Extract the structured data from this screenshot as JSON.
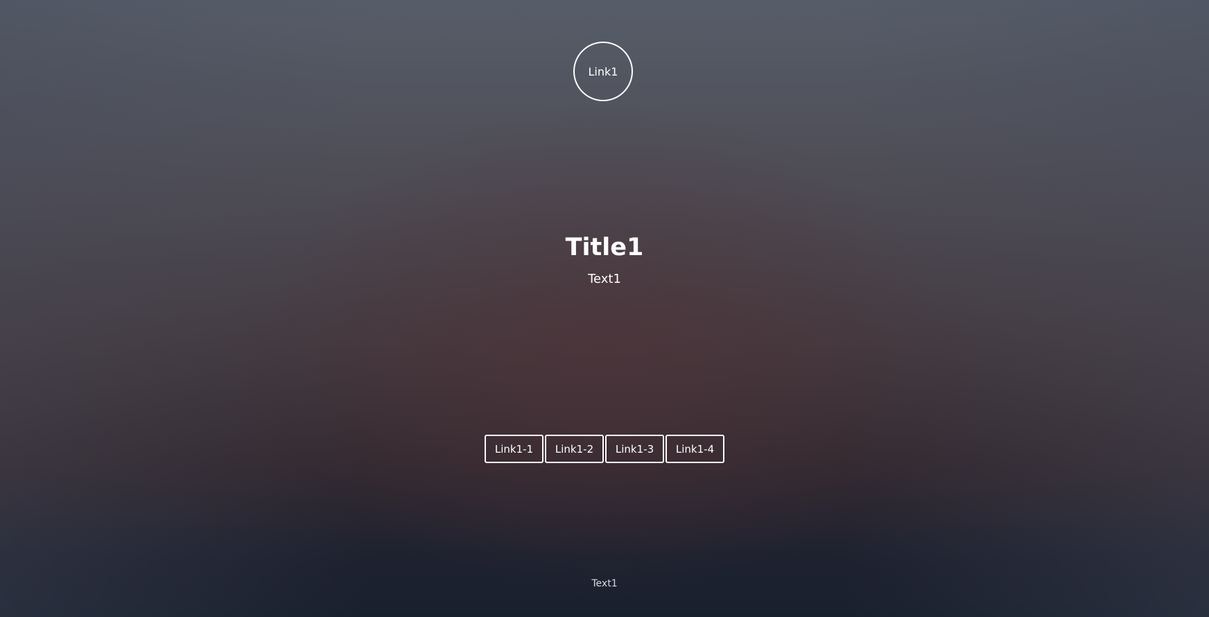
{
  "header": {
    "logo_link_label": "Link1"
  },
  "main": {
    "title": "Title1",
    "subtitle": "Text1",
    "nav_links": [
      "Link1-1",
      "Link1-2",
      "Link1-3",
      "Link1-4"
    ]
  },
  "footer": {
    "text": "Text1"
  },
  "colors": {
    "text": "#ffffff",
    "background_top": "#565d69",
    "background_bottom": "#18202e"
  }
}
